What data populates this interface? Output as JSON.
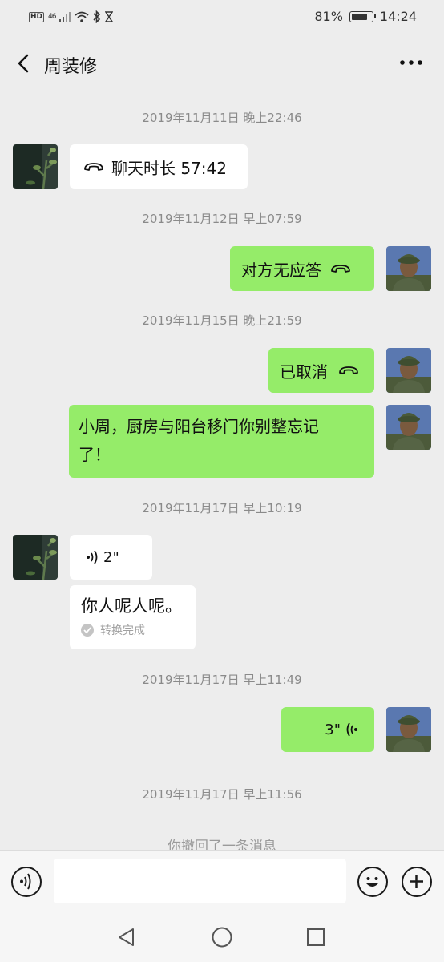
{
  "status_bar": {
    "network_badge": "HD",
    "signal_label": "46",
    "battery_percent": "81%",
    "battery_level": 0.81,
    "time": "14:24"
  },
  "header": {
    "title": "周装修",
    "back_icon": "chevron-left-icon",
    "more_icon": "more-dots-icon"
  },
  "messages": {
    "ts1": "2019年11月11日 晚上22:46",
    "m1_text": "聊天时长 57:42",
    "ts2": "2019年11月12日 早上07:59",
    "m2_text": "对方无应答",
    "ts3": "2019年11月15日 晚上21:59",
    "m3_text": "已取消",
    "m4_line1": "小周，厨房与阳台移门你别整忘记",
    "m4_line2": "了！",
    "ts4": "2019年11月17日 早上10:19",
    "m5_voice": "2\"",
    "m6_text": "你人呢人呢。",
    "m6_status": "转换完成",
    "ts5": "2019年11月17日 早上11:49",
    "m7_voice": "3\"",
    "ts6": "2019年11月17日 早上11:56",
    "recall": "你撤回了一条消息"
  },
  "input_bar": {
    "voice_icon": "voice-icon",
    "emoji_icon": "emoji-icon",
    "plus_icon": "plus-icon",
    "text_value": ""
  },
  "system_nav": {
    "back": "triangle-back-icon",
    "home": "circle-home-icon",
    "recents": "square-recents-icon"
  },
  "colors": {
    "background": "#ededed",
    "bubble_self": "#95ec69",
    "bubble_other": "#ffffff"
  }
}
